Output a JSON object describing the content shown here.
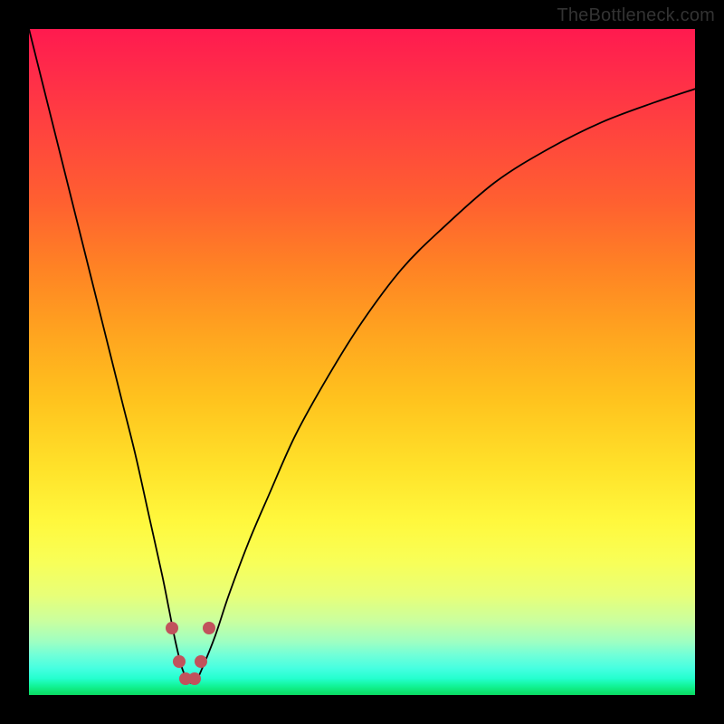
{
  "attribution": "TheBottleneck.com",
  "chart_data": {
    "type": "line",
    "title": "",
    "xlabel": "",
    "ylabel": "",
    "xlim": [
      0,
      100
    ],
    "ylim": [
      0,
      100
    ],
    "series": [
      {
        "name": "curve",
        "x": [
          0,
          2,
          4,
          6,
          8,
          10,
          12,
          14,
          16,
          18,
          20,
          21,
          22,
          23,
          24,
          25,
          26,
          28,
          30,
          33,
          36,
          40,
          45,
          50,
          56,
          62,
          70,
          78,
          86,
          94,
          100
        ],
        "y": [
          100,
          92,
          84,
          76,
          68,
          60,
          52,
          44,
          36,
          27,
          18,
          13,
          8,
          4,
          2,
          2,
          4,
          9,
          15,
          23,
          30,
          39,
          48,
          56,
          64,
          70,
          77,
          82,
          86,
          89,
          91
        ]
      }
    ],
    "markers": [
      {
        "x": 21.5,
        "y": 10
      },
      {
        "x": 22.5,
        "y": 5
      },
      {
        "x": 23.5,
        "y": 2.5
      },
      {
        "x": 24.8,
        "y": 2.5
      },
      {
        "x": 25.8,
        "y": 5
      },
      {
        "x": 27.0,
        "y": 10
      }
    ],
    "background_gradient": {
      "orientation": "vertical",
      "stops": [
        {
          "pos": 0.0,
          "color": "#ff1a4f"
        },
        {
          "pos": 0.7,
          "color": "#fff83d"
        },
        {
          "pos": 1.0,
          "color": "#0bd862"
        }
      ]
    }
  }
}
